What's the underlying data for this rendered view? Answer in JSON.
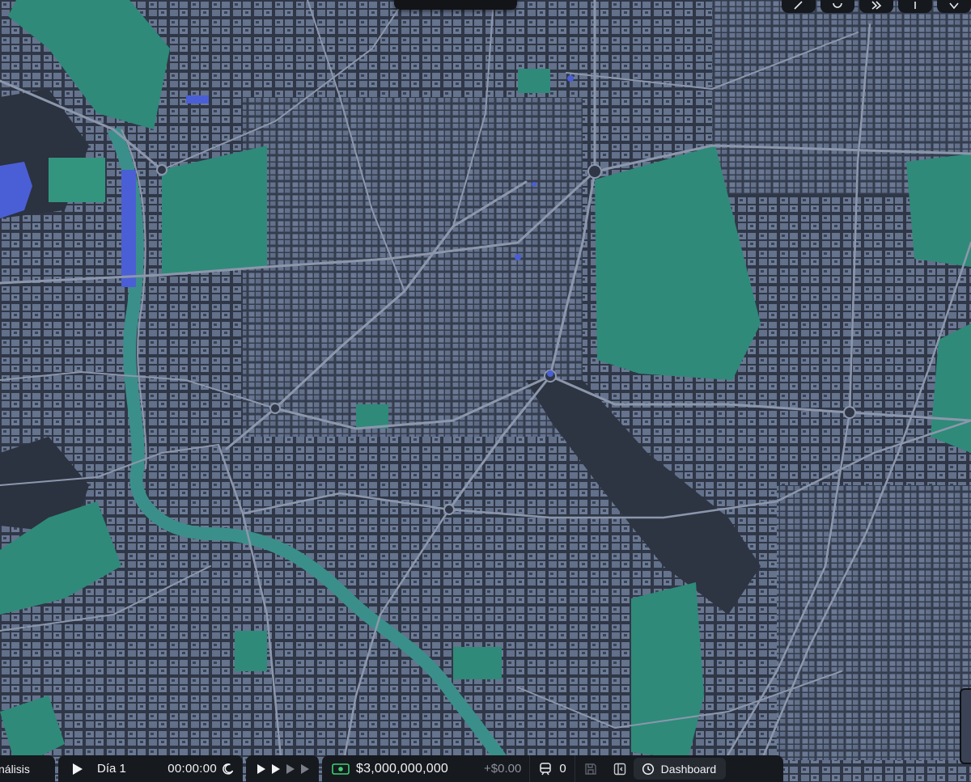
{
  "map": {
    "colors": {
      "land": "#2f3747",
      "blocks": "#6a7893",
      "roads": "#8c97ac",
      "parks": "#2f8a79",
      "water": "#4a5fd6",
      "river": "#3b8f8a"
    }
  },
  "bottom_bar": {
    "analysis_label": "nálisis",
    "day_label": "Día 1",
    "clock": "00:00:00",
    "speed_icons": [
      "speed-1-icon",
      "speed-2-icon",
      "speed-3-icon",
      "speed-4-icon"
    ],
    "money": "$3,000,000,000",
    "money_delta": "+$0.00",
    "trains_count": "0",
    "dashboard_label": "Dashboard"
  },
  "icons": {
    "play": "play-icon",
    "moon": "moon-icon",
    "cash": "cash-icon",
    "train": "train-icon",
    "save": "save-icon",
    "collapse": "collapse-panel-icon",
    "clock": "clock-icon"
  }
}
